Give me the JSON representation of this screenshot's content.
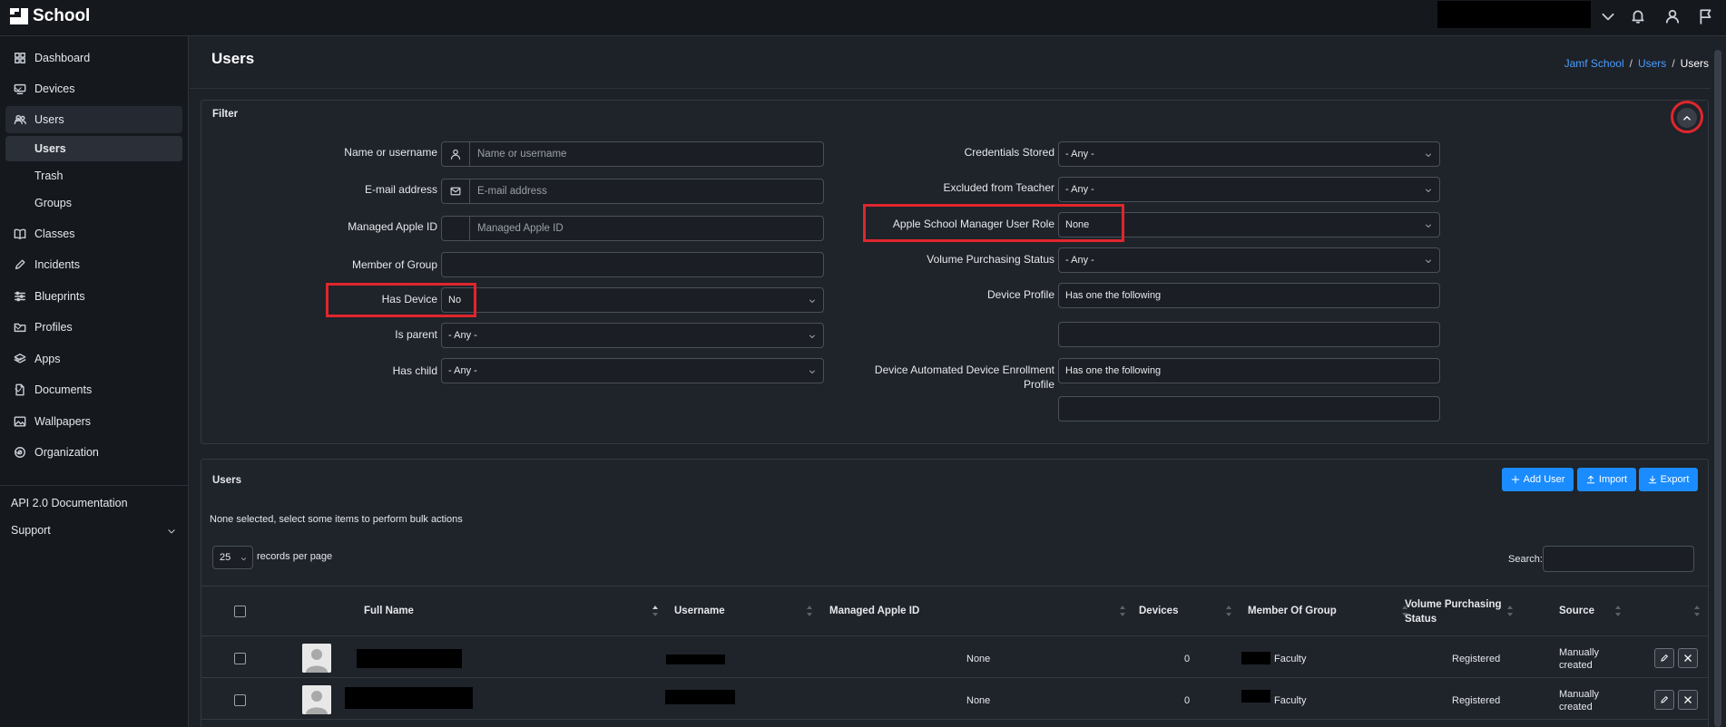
{
  "app": {
    "title": "School"
  },
  "sidebar": {
    "items": [
      {
        "label": "Dashboard",
        "icon": "dashboard-icon"
      },
      {
        "label": "Devices",
        "icon": "monitor-icon"
      },
      {
        "label": "Users",
        "icon": "users-icon"
      },
      {
        "label": "Classes",
        "icon": "book-icon"
      },
      {
        "label": "Incidents",
        "icon": "pen-icon"
      },
      {
        "label": "Blueprints",
        "icon": "sliders-icon"
      },
      {
        "label": "Profiles",
        "icon": "folder-icon"
      },
      {
        "label": "Apps",
        "icon": "layers-icon"
      },
      {
        "label": "Documents",
        "icon": "document-icon"
      },
      {
        "label": "Wallpapers",
        "icon": "image-icon"
      },
      {
        "label": "Organization",
        "icon": "target-icon"
      }
    ],
    "users_sub": [
      "Users",
      "Trash",
      "Groups"
    ],
    "api_docs": "API 2.0 Documentation",
    "support": "Support"
  },
  "page": {
    "title": "Users",
    "breadcrumb": [
      "Jamf School",
      "Users",
      "Users"
    ]
  },
  "filter": {
    "title": "Filter",
    "name_label": "Name or username",
    "name_placeholder": "Name or username",
    "email_label": "E-mail address",
    "email_placeholder": "E-mail address",
    "apple_id_label": "Managed Apple ID",
    "apple_id_placeholder": "Managed Apple ID",
    "group_label": "Member of Group",
    "has_device_label": "Has Device",
    "has_device_value": "No",
    "is_parent_label": "Is parent",
    "is_parent_value": "- Any -",
    "has_child_label": "Has child",
    "has_child_value": "- Any -",
    "credentials_label": "Credentials Stored",
    "credentials_value": "- Any -",
    "excluded_label": "Excluded from Teacher",
    "excluded_value": "- Any -",
    "asm_role_label": "Apple School Manager User Role",
    "asm_role_value": "None",
    "vpp_label": "Volume Purchasing Status",
    "vpp_value": "- Any -",
    "device_profile_label": "Device Profile",
    "device_profile_value": "Has one the following",
    "ade_label_1": "Device Automated Device Enrollment",
    "ade_label_2": "Profile",
    "ade_value": "Has one the following"
  },
  "users_table": {
    "title": "Users",
    "add_label": "Add User",
    "import_label": "Import",
    "export_label": "Export",
    "bulk_note": "None selected, select some items to perform bulk actions",
    "per_page": "25",
    "per_page_label": "records per page",
    "search_label": "Search:",
    "columns": [
      "Full Name",
      "Username",
      "Managed Apple ID",
      "Devices",
      "Member Of Group",
      "Volume Purchasing",
      "Status",
      "Source"
    ],
    "rows": [
      {
        "apple_id": "None",
        "devices": "0",
        "group": "Faculty",
        "vpp": "Registered",
        "source_1": "Manually",
        "source_2": "created"
      },
      {
        "apple_id": "None",
        "devices": "0",
        "group": "Faculty",
        "vpp": "Registered",
        "source_1": "Manually",
        "source_2": "created"
      }
    ]
  },
  "colors": {
    "accent": "#1a8cff",
    "highlight": "#e0262d",
    "background": "#1d2128",
    "sidebar": "#15181d"
  }
}
